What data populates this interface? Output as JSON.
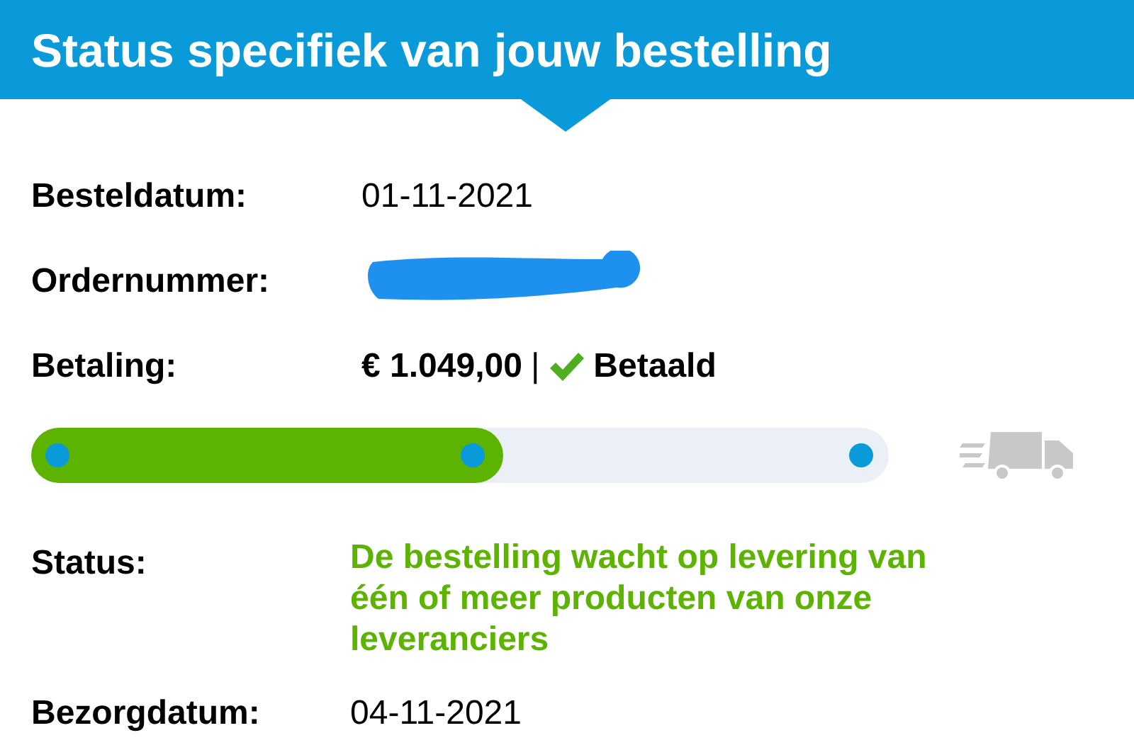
{
  "header": {
    "title": "Status specifiek van jouw bestelling"
  },
  "fields": [
    {
      "label": "Besteldatum:",
      "value": "01-11-2021"
    },
    {
      "label": "Ordernummer:",
      "redacted": true
    },
    {
      "label": "Betaling:",
      "amount": "€ 1.049,00",
      "separator": "|",
      "paid": true,
      "paid_label": "Betaald"
    }
  ],
  "progress": {
    "level": 0.55,
    "steps": [
      {
        "kind": "dot"
      },
      {
        "kind": "dot"
      },
      {
        "kind": "dot"
      }
    ]
  },
  "status": {
    "label": "Status:",
    "value": "De bestelling wacht op levering van één of meer producten van onze leveranciers"
  },
  "delivery": {
    "label": "Bezorgdatum:",
    "value": "04-11-2021"
  }
}
